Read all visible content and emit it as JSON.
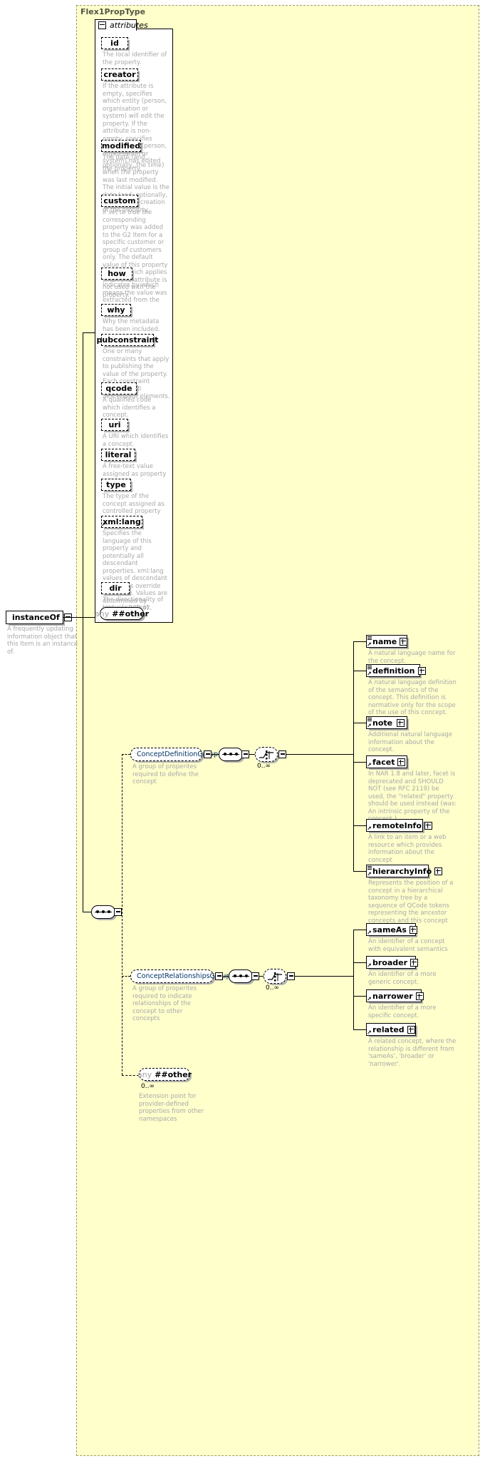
{
  "diagram": {
    "title": "Flex1PropType",
    "attributes_tab_label": "attributes"
  },
  "root": {
    "label": "instanceOf",
    "doc": "A frequently updating information object that this Item is an instance of."
  },
  "attributes": [
    {
      "name": "id",
      "doc": "The local identifier of the property."
    },
    {
      "name": "creator",
      "doc": "If the attribute is empty, specifies which entity (person, organisation or system) will edit the property. If the attribute is non-empty, specifies which entity (person, organisation or system) has edited the property."
    },
    {
      "name": "modified",
      "doc": "The date (and, optionally, the time) when the property was last modified. The initial value is the date (and, optionally, the time) of creation of the property."
    },
    {
      "name": "custom",
      "doc": "If set to true the corresponding property was added to the G2 Item for a specific customer or group of customers only. The default value of this property is false which applies when this attribute is not used with the property."
    },
    {
      "name": "how",
      "doc": "Indicates by which means the value was extracted from the content."
    },
    {
      "name": "why",
      "doc": "Why the metadata has been included."
    },
    {
      "name": "pubconstraint",
      "doc": "One or many constraints that apply to publishing the value of the property. Each constraint applies to all descendant elements."
    },
    {
      "name": "qcode",
      "doc": "A qualified code which identifies a concept."
    },
    {
      "name": "uri",
      "doc": "A URI which identifies a concept."
    },
    {
      "name": "literal",
      "doc": "A free-text value assigned as property value."
    },
    {
      "name": "type",
      "doc": "The type of the concept assigned as controlled property value."
    },
    {
      "name": "xml:lang",
      "doc": "Specifies the language of this property and potentially all descendant properties. xml:lang values of descendant properties override this value. Values are determined by Internet BCP 47."
    },
    {
      "name": "dir",
      "doc": "The directionality of textual content."
    }
  ],
  "attributes_any": {
    "any_label": "any",
    "other_label": "##other"
  },
  "groups": [
    {
      "id": "conceptDefinitionGroup",
      "label": "ConceptDefinitionGroup",
      "doc": "A group of properites required to define the concept",
      "occurs": "0..∞",
      "children": [
        {
          "name": "name",
          "doc": "A natural language name for the concept."
        },
        {
          "name": "definition",
          "doc": "A natural language definition of the semantics of the concept. This definition is normative only for the scope of the use of this concept."
        },
        {
          "name": "note",
          "doc": "Additional natural language information about the concept."
        },
        {
          "name": "facet",
          "doc": "In NAR 1.8 and later, facet is deprecated and SHOULD NOT (see RFC 2119) be used, the \"related\" property should be used instead (was: An intrinsic property of the concept.)"
        },
        {
          "name": "remoteInfo",
          "doc": "A link to an item or a web resource which provides information about the concept"
        },
        {
          "name": "hierarchyInfo",
          "doc": "Represents the position of a concept in a hierarchical taxonomy tree by a sequence of QCode tokens representing the ancestor concepts and this concept"
        }
      ]
    },
    {
      "id": "conceptRelationshipsGroup",
      "label": "ConceptRelationshipsGroup",
      "doc": "A group of properites required to indicate relationships of the concept to other concepts",
      "occurs": "0..∞",
      "children": [
        {
          "name": "sameAs",
          "doc": "An identifier of a concept with equivalent semantics"
        },
        {
          "name": "broader",
          "doc": "An identifier of a more generic concept."
        },
        {
          "name": "narrower",
          "doc": "An identifier of a more specific concept."
        },
        {
          "name": "related",
          "doc": "A related concept, where the relationship is different from 'sameAs', 'broader' or 'narrower'."
        }
      ]
    }
  ],
  "content_any": {
    "any_label": "any",
    "other_label": "##other",
    "occurs": "0..∞",
    "doc": "Extension point for provider-defined properties from other namespaces"
  },
  "icons": {
    "collapse": "minus-box-icon",
    "expand": "plus-box-icon",
    "sequence": "sequence-connector-icon",
    "choice": "choice-connector-icon",
    "reference": "reference-arrow-icon"
  },
  "colors": {
    "group_background": "#ffffcc",
    "node_background": "#ffffff",
    "doc_text": "#a8a8a8",
    "group_label": "#003366",
    "title": "#555544"
  }
}
